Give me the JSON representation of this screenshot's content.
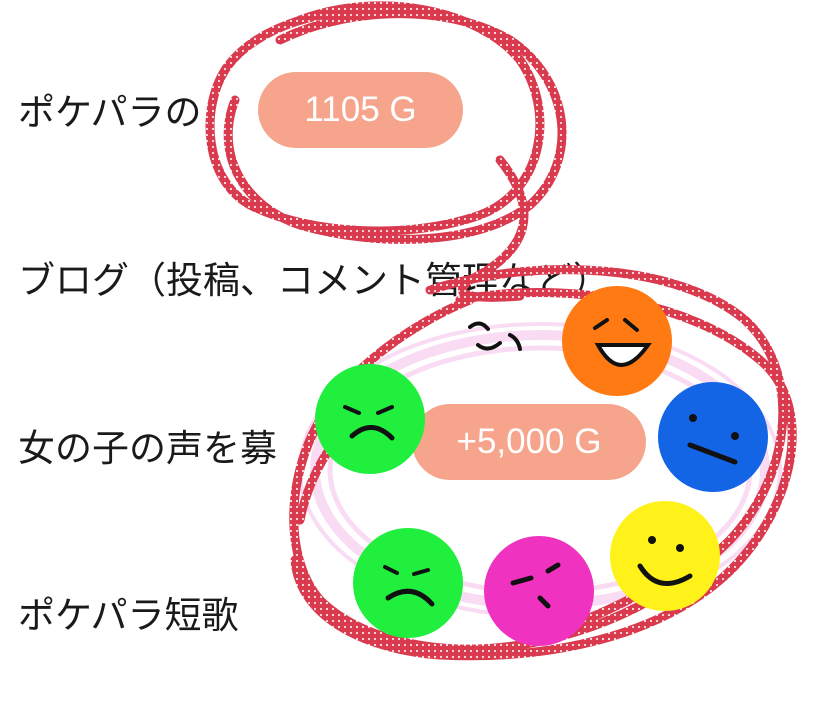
{
  "menu": {
    "items": [
      {
        "label": "ポケパラの"
      },
      {
        "label": "ブログ（投稿、コメント管理など）"
      },
      {
        "label": "女の子の声を募"
      },
      {
        "label": "ポケパラ短歌"
      }
    ]
  },
  "badges": {
    "balance": "1105 G",
    "reward": "+5,000 G"
  },
  "colors": {
    "pill": "#f6a58c",
    "scribble": "#d93a4e",
    "ring": "#f6c6ec",
    "faces": [
      "#ff7a12",
      "#1464e6",
      "#fff21a",
      "#ef33c0",
      "#20ef3e",
      "#20ef3e"
    ]
  },
  "faces": [
    {
      "name": "laughing",
      "color": "#ff7a12"
    },
    {
      "name": "neutral",
      "color": "#1464e6"
    },
    {
      "name": "smiling",
      "color": "#fff21a"
    },
    {
      "name": "annoyed",
      "color": "#ef33c0"
    },
    {
      "name": "worried",
      "color": "#20ef3e"
    },
    {
      "name": "worried",
      "color": "#20ef3e"
    }
  ]
}
